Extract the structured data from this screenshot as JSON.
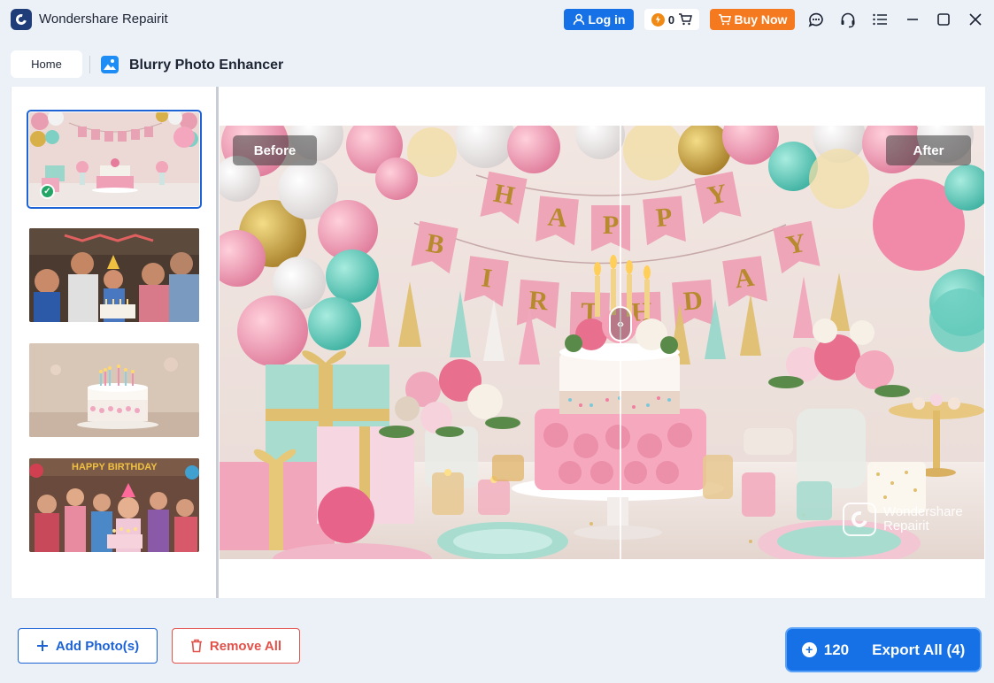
{
  "app": {
    "title": "Wondershare Repairit"
  },
  "titlebar": {
    "login_label": "Log in",
    "coin_count": "0",
    "buy_label": "Buy Now"
  },
  "tabs": {
    "home_label": "Home",
    "tool_title": "Blurry Photo Enhancer"
  },
  "thumbnails": [
    {
      "subject": "birthday party table with cake and balloons",
      "selected": true
    },
    {
      "subject": "family celebrating birthday with cake"
    },
    {
      "subject": "birthday cake with candles"
    },
    {
      "subject": "children blowing birthday candles",
      "banner": "HAPPY BIRTHDAY"
    }
  ],
  "preview": {
    "before_label": "Before",
    "after_label": "After",
    "banner_row1": [
      "H",
      "A",
      "P",
      "P",
      "Y"
    ],
    "banner_row2": [
      "B",
      "I",
      "R",
      "T",
      "H",
      "D",
      "A",
      "Y"
    ],
    "watermark_line1": "Wondershare",
    "watermark_line2": "Repairit"
  },
  "bottom": {
    "add_label": "Add Photo(s)",
    "remove_label": "Remove All",
    "export_credits": "120",
    "export_label": "Export All (4)"
  },
  "colors": {
    "accent": "#1670e6",
    "buy": "#f57a1f",
    "danger": "#e2514a",
    "success": "#22a565"
  }
}
